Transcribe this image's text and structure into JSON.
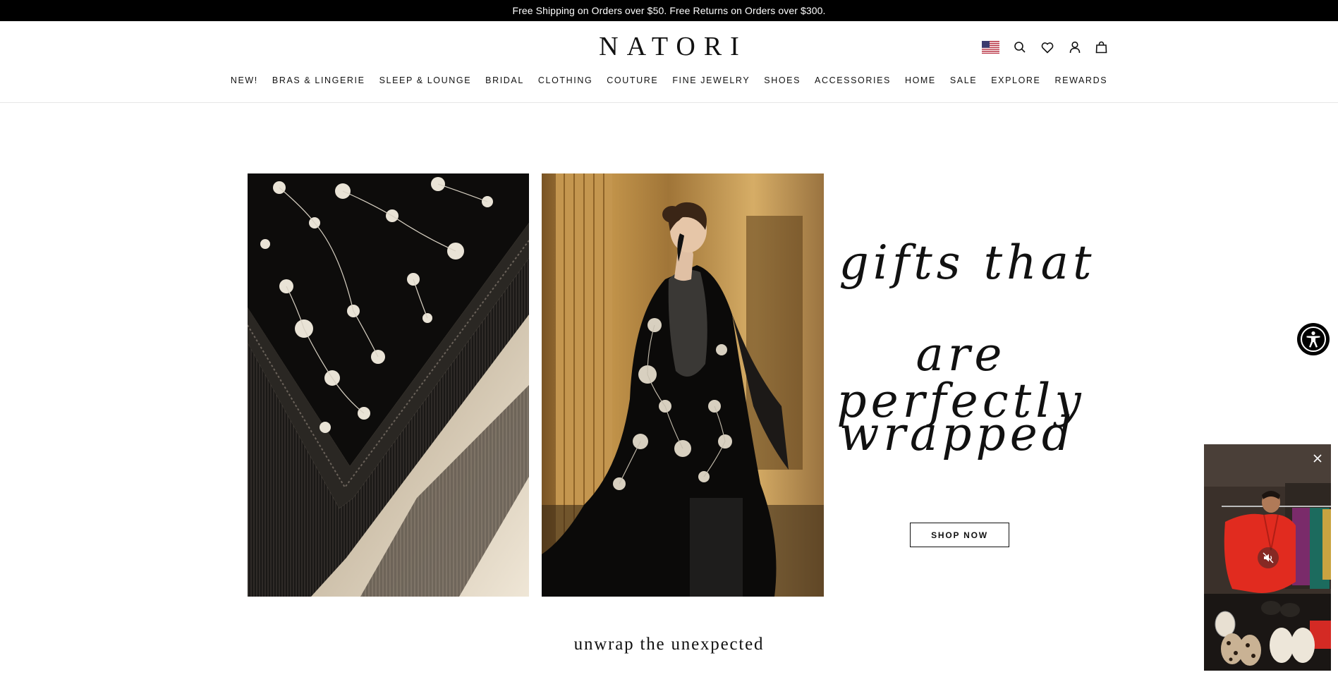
{
  "announcement": "Free Shipping on Orders over $50. Free Returns on Orders over $300.",
  "brand": {
    "logo_text": "NATORI"
  },
  "utility_icons": [
    "us-flag-icon",
    "search-icon",
    "heart-icon",
    "account-icon",
    "bag-icon"
  ],
  "nav": {
    "items": [
      "NEW!",
      "BRAS & LINGERIE",
      "SLEEP & LOUNGE",
      "BRIDAL",
      "CLOTHING",
      "COUTURE",
      "FINE JEWELRY",
      "SHOES",
      "ACCESSORIES",
      "HOME",
      "SALE",
      "EXPLORE",
      "REWARDS"
    ]
  },
  "hero": {
    "headline_lines": [
      "gifts that",
      "are perfectly",
      "wrapped"
    ],
    "cta_label": "SHOP NOW",
    "images": [
      "embroidered-shawl-closeup",
      "model-wearing-fringed-shawl"
    ]
  },
  "section": {
    "tagline": "unwrap the unexpected"
  },
  "video_widget": {
    "icons": [
      "close-icon",
      "mute-icon"
    ]
  },
  "colors": {
    "announcement_bg": "#000000",
    "text": "#111111",
    "background": "#ffffff"
  }
}
